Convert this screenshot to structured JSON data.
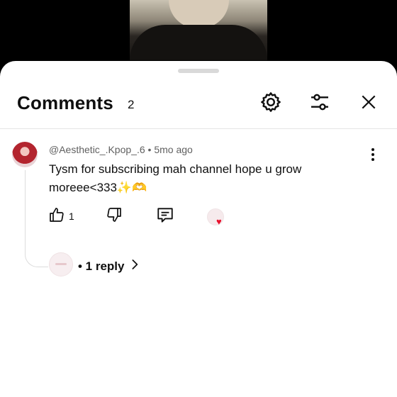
{
  "header": {
    "title": "Comments",
    "count": "2"
  },
  "comment": {
    "author": "@Aesthetic_.Kpop_.6",
    "separator": "•",
    "time": "5mo ago",
    "text": "Tysm for subscribing mah channel hope u grow moreee<333✨🫶",
    "like_count": "1"
  },
  "replies": {
    "label": "• 1 reply"
  },
  "icons": {
    "settings": "gear-icon",
    "filter": "sliders-icon",
    "close": "close-icon",
    "more": "more-vert-icon",
    "like": "thumbs-up-icon",
    "dislike": "thumbs-down-icon",
    "reply": "comment-icon",
    "creator_heart": "heart-icon",
    "chevron": "chevron-right-icon"
  },
  "colors": {
    "heart": "#e8112d",
    "text": "#0f0f0f",
    "meta": "#606060"
  }
}
